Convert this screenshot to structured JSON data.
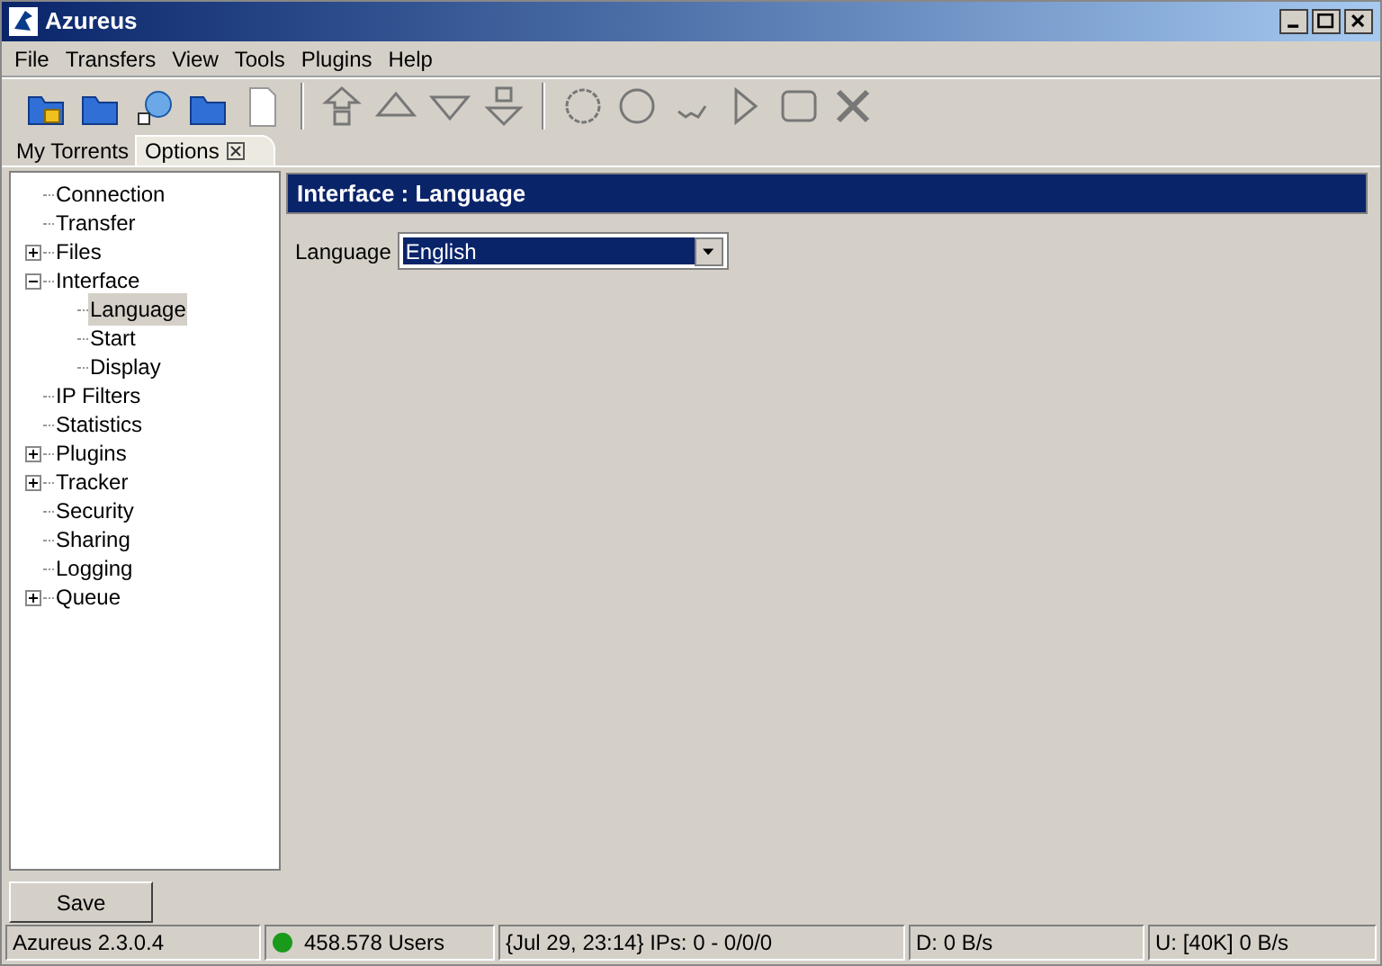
{
  "window": {
    "title": "Azureus"
  },
  "menu": [
    "File",
    "Transfers",
    "View",
    "Tools",
    "Plugins",
    "Help"
  ],
  "tabs": [
    {
      "label": "My Torrents",
      "selected": false,
      "closable": false
    },
    {
      "label": "Options",
      "selected": true,
      "closable": true
    }
  ],
  "tree": [
    {
      "label": "Connection",
      "selected": false
    },
    {
      "label": "Transfer",
      "selected": false
    },
    {
      "label": "Files",
      "selected": false,
      "expanded": false
    },
    {
      "label": "Interface",
      "selected": false,
      "expanded": true,
      "children": [
        {
          "label": "Language",
          "selected": true
        },
        {
          "label": "Start",
          "selected": false
        },
        {
          "label": "Display",
          "selected": false
        }
      ]
    },
    {
      "label": "IP Filters",
      "selected": false
    },
    {
      "label": "Statistics",
      "selected": false
    },
    {
      "label": "Plugins",
      "selected": false,
      "expanded": false
    },
    {
      "label": "Tracker",
      "selected": false,
      "expanded": false
    },
    {
      "label": "Security",
      "selected": false
    },
    {
      "label": "Sharing",
      "selected": false
    },
    {
      "label": "Logging",
      "selected": false
    },
    {
      "label": "Queue",
      "selected": false,
      "expanded": false
    }
  ],
  "panel": {
    "title": "Interface : Language",
    "field_label": "Language",
    "field_value": "English"
  },
  "save_button": "Save",
  "status_bar": [
    "Azureus 2.3.0.4",
    "458.578 Users",
    "{Jul 29, 23:14} IPs: 0 - 0/0/0",
    "D: 0 B/s",
    "U: [40K] 0 B/s"
  ]
}
